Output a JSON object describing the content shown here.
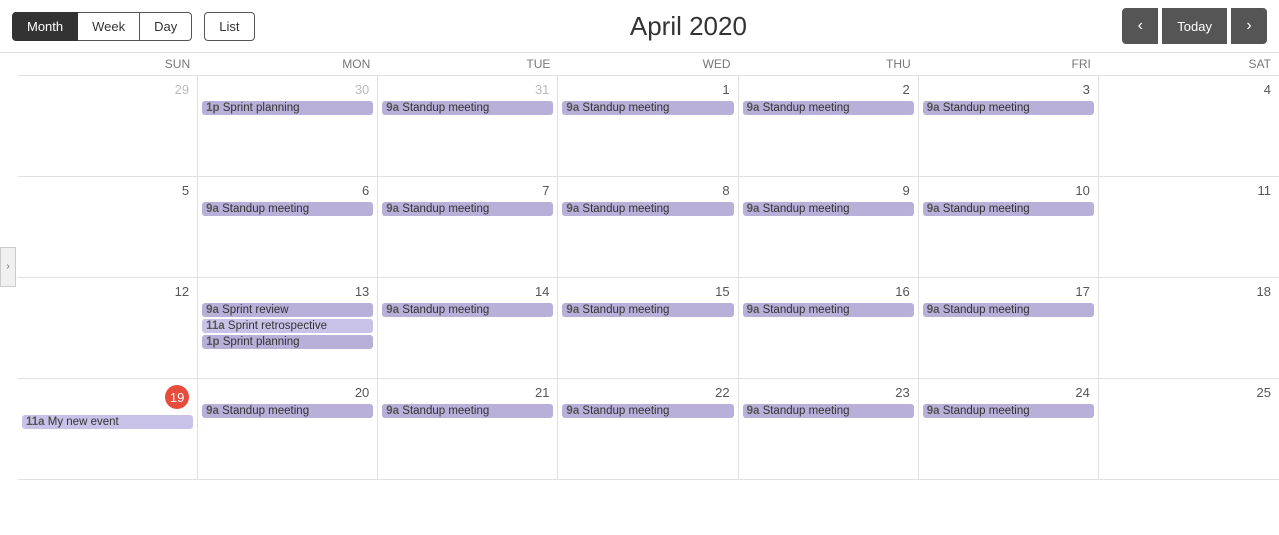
{
  "header": {
    "view_buttons": [
      {
        "label": "Month",
        "active": true
      },
      {
        "label": "Week",
        "active": false
      },
      {
        "label": "Day",
        "active": false
      }
    ],
    "list_button": "List",
    "title": "April 2020",
    "nav": {
      "prev": "‹",
      "today": "Today",
      "next": "›"
    }
  },
  "day_names": [
    "SUN",
    "MON",
    "TUE",
    "WED",
    "THU",
    "FRI",
    "SAT"
  ],
  "weeks": [
    {
      "days": [
        {
          "date": "29",
          "other_month": true,
          "events": []
        },
        {
          "date": "30",
          "other_month": true,
          "events": [
            {
              "time": "1p",
              "title": "Sprint planning",
              "style": "purple"
            }
          ]
        },
        {
          "date": "31",
          "other_month": true,
          "events": [
            {
              "time": "9a",
              "title": "Standup meeting",
              "style": "purple"
            }
          ]
        },
        {
          "date": "1",
          "events": [
            {
              "time": "9a",
              "title": "Standup meeting",
              "style": "purple"
            }
          ]
        },
        {
          "date": "2",
          "events": [
            {
              "time": "9a",
              "title": "Standup meeting",
              "style": "purple"
            }
          ]
        },
        {
          "date": "3",
          "events": [
            {
              "time": "9a",
              "title": "Standup meeting",
              "style": "purple"
            }
          ]
        },
        {
          "date": "4",
          "events": []
        }
      ]
    },
    {
      "days": [
        {
          "date": "5",
          "events": []
        },
        {
          "date": "6",
          "events": [
            {
              "time": "9a",
              "title": "Standup meeting",
              "style": "purple"
            }
          ]
        },
        {
          "date": "7",
          "events": [
            {
              "time": "9a",
              "title": "Standup meeting",
              "style": "purple"
            }
          ]
        },
        {
          "date": "8",
          "events": [
            {
              "time": "9a",
              "title": "Standup meeting",
              "style": "purple"
            }
          ]
        },
        {
          "date": "9",
          "events": [
            {
              "time": "9a",
              "title": "Standup meeting",
              "style": "purple"
            }
          ]
        },
        {
          "date": "10",
          "events": [
            {
              "time": "9a",
              "title": "Standup meeting",
              "style": "purple"
            }
          ]
        },
        {
          "date": "11",
          "events": []
        }
      ]
    },
    {
      "days": [
        {
          "date": "12",
          "events": []
        },
        {
          "date": "13",
          "events": [
            {
              "time": "9a",
              "title": "Sprint review",
              "style": "purple"
            },
            {
              "time": "11a",
              "title": "Sprint retrospective",
              "style": "light-purple"
            },
            {
              "time": "1p",
              "title": "Sprint planning",
              "style": "purple"
            }
          ]
        },
        {
          "date": "14",
          "events": [
            {
              "time": "9a",
              "title": "Standup meeting",
              "style": "purple"
            }
          ]
        },
        {
          "date": "15",
          "events": [
            {
              "time": "9a",
              "title": "Standup meeting",
              "style": "purple"
            }
          ]
        },
        {
          "date": "16",
          "events": [
            {
              "time": "9a",
              "title": "Standup meeting",
              "style": "purple"
            }
          ]
        },
        {
          "date": "17",
          "events": [
            {
              "time": "9a",
              "title": "Standup meeting",
              "style": "purple"
            }
          ]
        },
        {
          "date": "18",
          "events": []
        }
      ]
    },
    {
      "days": [
        {
          "date": "19",
          "today": true,
          "events": [
            {
              "time": "11a",
              "title": "My new event",
              "style": "light-purple"
            }
          ]
        },
        {
          "date": "20",
          "events": [
            {
              "time": "9a",
              "title": "Standup meeting",
              "style": "purple"
            }
          ]
        },
        {
          "date": "21",
          "events": [
            {
              "time": "9a",
              "title": "Standup meeting",
              "style": "purple"
            }
          ]
        },
        {
          "date": "22",
          "events": [
            {
              "time": "9a",
              "title": "Standup meeting",
              "style": "purple"
            }
          ]
        },
        {
          "date": "23",
          "events": [
            {
              "time": "9a",
              "title": "Standup meeting",
              "style": "purple"
            }
          ]
        },
        {
          "date": "24",
          "events": [
            {
              "time": "9a",
              "title": "Standup meeting",
              "style": "purple"
            }
          ]
        },
        {
          "date": "25",
          "events": []
        }
      ]
    }
  ]
}
